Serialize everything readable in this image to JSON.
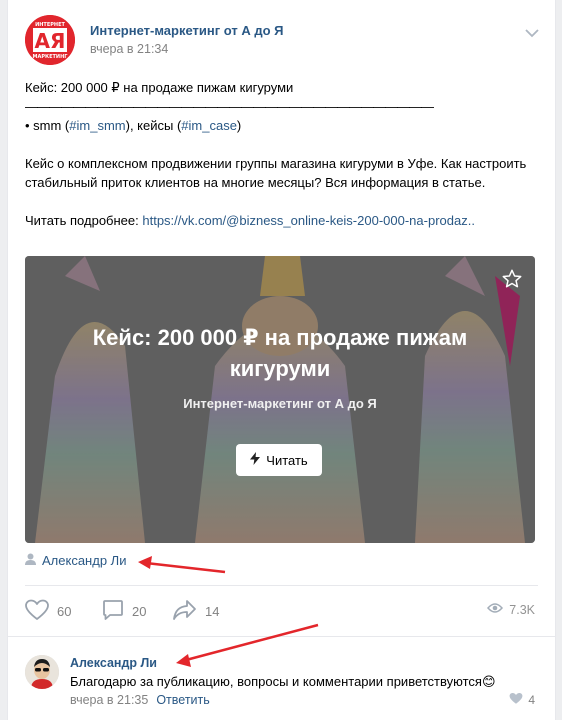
{
  "post": {
    "group_name": "Интернет-маркетинг от А до Я",
    "date": "вчера в 21:34",
    "avatar_text_top": "ИНТЕРНЕТ",
    "avatar_letters": "АЯ",
    "avatar_text_bottom": "МАРКЕТИНГ",
    "title_line": "Кейс: 200 000 ₽ на продаже пижам кигуруми",
    "divider": "——————————————————————————————————",
    "tags_prefix": "• smm (",
    "tag_smm": "#im_smm",
    "tags_middle": "), кейсы (",
    "tag_case": "#im_case",
    "tags_suffix": ")",
    "paragraph": "Кейс о комплексном продвижении группы магазина кигуруми в Уфе. Как настроить стабильный приток клиентов на многие месяцы? Вся информация в статье.",
    "read_more_label": "Читать подробнее: ",
    "read_more_link": "https://vk.com/@bizness_online-keis-200-000-na-prodaz.."
  },
  "snippet": {
    "title": "Кейс: 200 000 ₽ на продаже пижам кигуруми",
    "subtitle": "Интернет-маркетинг от А до Я",
    "button": "Читать"
  },
  "author": {
    "name": "Александр Ли"
  },
  "actions": {
    "likes": "60",
    "comments": "20",
    "shares": "14",
    "views": "7.3K"
  },
  "comment": {
    "author": "Александр Ли",
    "text": "Благодарю за публикацию, вопросы и комментарии приветствуются",
    "emoji": "😊",
    "date": "вчера в 21:35",
    "reply": "Ответить",
    "likes": "4"
  },
  "colors": {
    "link": "#2a5885",
    "muted": "#828282",
    "annotation_arrow": "#e3262b"
  }
}
